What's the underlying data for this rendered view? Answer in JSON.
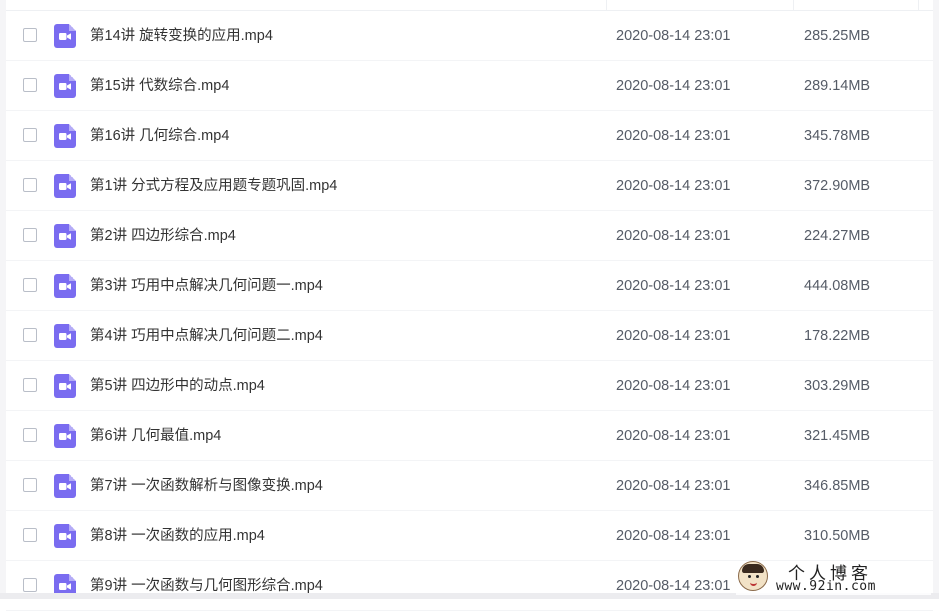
{
  "files": [
    {
      "name": "第14讲 旋转变换的应用.mp4",
      "date": "2020-08-14 23:01",
      "size": "285.25MB"
    },
    {
      "name": "第15讲 代数综合.mp4",
      "date": "2020-08-14 23:01",
      "size": "289.14MB"
    },
    {
      "name": "第16讲 几何综合.mp4",
      "date": "2020-08-14 23:01",
      "size": "345.78MB"
    },
    {
      "name": "第1讲 分式方程及应用题专题巩固.mp4",
      "date": "2020-08-14 23:01",
      "size": "372.90MB"
    },
    {
      "name": "第2讲 四边形综合.mp4",
      "date": "2020-08-14 23:01",
      "size": "224.27MB"
    },
    {
      "name": "第3讲 巧用中点解决几何问题一.mp4",
      "date": "2020-08-14 23:01",
      "size": "444.08MB"
    },
    {
      "name": "第4讲 巧用中点解决几何问题二.mp4",
      "date": "2020-08-14 23:01",
      "size": "178.22MB"
    },
    {
      "name": "第5讲 四边形中的动点.mp4",
      "date": "2020-08-14 23:01",
      "size": "303.29MB"
    },
    {
      "name": "第6讲 几何最值.mp4",
      "date": "2020-08-14 23:01",
      "size": "321.45MB"
    },
    {
      "name": "第7讲 一次函数解析与图像变换.mp4",
      "date": "2020-08-14 23:01",
      "size": "346.85MB"
    },
    {
      "name": "第8讲 一次函数的应用.mp4",
      "date": "2020-08-14 23:01",
      "size": "310.50MB"
    },
    {
      "name": "第9讲 一次函数与几何图形综合.mp4",
      "date": "2020-08-14 23:01",
      "size": ""
    }
  ],
  "icons": {
    "file_type": "video-file-icon",
    "selection": "checkbox"
  },
  "colors": {
    "video_icon": "#7a6cf0",
    "text_primary": "#333333",
    "text_secondary": "#555b66"
  },
  "watermark": {
    "title": "个人博客",
    "url": "www.92in.com"
  }
}
